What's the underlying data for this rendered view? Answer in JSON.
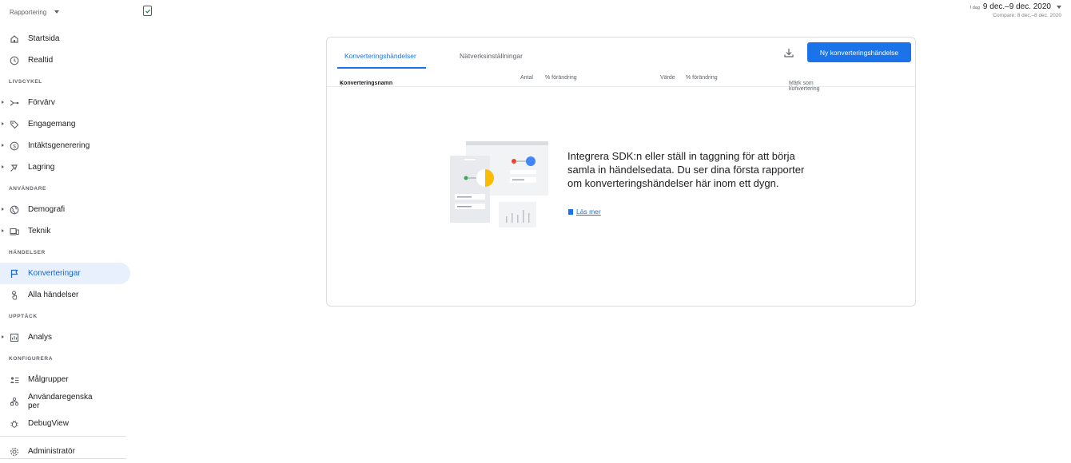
{
  "property": {
    "label": "Rapportering"
  },
  "date": {
    "today_label": "I dag",
    "range": "9 dec.–9 dec. 2020",
    "compare": "Compare: 8 dec.–8 dec. 2020"
  },
  "sidebar": {
    "items": [
      {
        "label": "Startsida",
        "icon": "home-icon"
      },
      {
        "label": "Realtid",
        "icon": "clock-icon"
      },
      {
        "section": "LIVSCYKEL"
      },
      {
        "label": "Förvärv",
        "icon": "acquisition-icon"
      },
      {
        "label": "Engagemang",
        "icon": "tag-icon"
      },
      {
        "label": "Intäktsgenerering",
        "icon": "dollar-icon"
      },
      {
        "label": "Lagring",
        "icon": "retention-icon"
      },
      {
        "section": "ANVÄNDARE"
      },
      {
        "label": "Demografi",
        "icon": "globe-icon"
      },
      {
        "label": "Teknik",
        "icon": "devices-icon"
      },
      {
        "section": "HÄNDELSER"
      },
      {
        "label": "Konverteringar",
        "icon": "flag-icon"
      },
      {
        "label": "Alla händelser",
        "icon": "touch-icon"
      },
      {
        "section": "UPPTÄCK"
      },
      {
        "label": "Analys",
        "icon": "analysis-icon"
      },
      {
        "section": "KONFIGURERA"
      },
      {
        "label": "Målgrupper",
        "icon": "audience-icon"
      },
      {
        "label": "Användaregenska per",
        "icon": "properties-icon"
      },
      {
        "label": "DebugView",
        "icon": "bug-icon"
      },
      {
        "label": "Administratör",
        "icon": "gear-icon"
      }
    ]
  },
  "card": {
    "tabs": [
      "Konverteringshändelser",
      "Nätverksinställningar"
    ],
    "new_button": "Ny konverteringshändelse",
    "columns": {
      "name": "Konverteringsnamn",
      "count": "Antal",
      "count_change": "% förändring",
      "value": "Värde",
      "value_change": "% förändring",
      "mark": "Märk som konvertering"
    },
    "empty": {
      "message": "Integrera SDK:n eller ställ in taggning för att börja samla in händelsedata. Du ser dina första rapporter om konverteringshändelser här inom ett dygn.",
      "link": "Läs mer"
    }
  },
  "colors": {
    "accent": "#1a73e8",
    "active_bg": "#e8f0fe"
  }
}
